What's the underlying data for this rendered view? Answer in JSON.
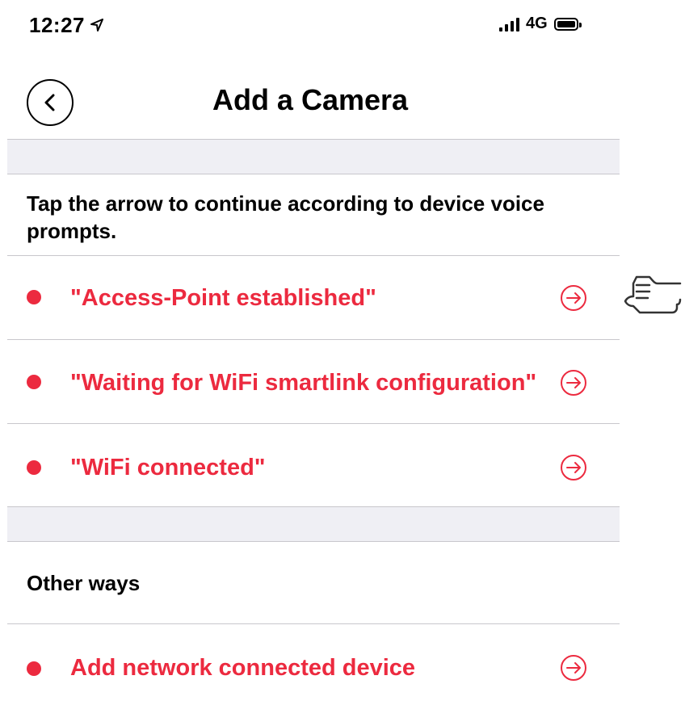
{
  "status_bar": {
    "time": "12:27",
    "network": "4G"
  },
  "header": {
    "title": "Add a Camera"
  },
  "instructions": "Tap the arrow to continue according to device voice prompts.",
  "prompts": [
    {
      "label": "\"Access-Point established\""
    },
    {
      "label": "\"Waiting for WiFi smartlink configuration\""
    },
    {
      "label": "\"WiFi connected\""
    }
  ],
  "other_section": {
    "heading": "Other ways",
    "items": [
      {
        "label": "Add network connected device"
      }
    ]
  },
  "colors": {
    "accent": "#ec2a3f",
    "band": "#efeff4",
    "divider": "#c8c7cc"
  },
  "icons": {
    "back": "chevron-left-icon",
    "row_action": "arrow-right-circle-icon",
    "pointer": "pointing-hand-icon",
    "location": "location-arrow-icon"
  }
}
